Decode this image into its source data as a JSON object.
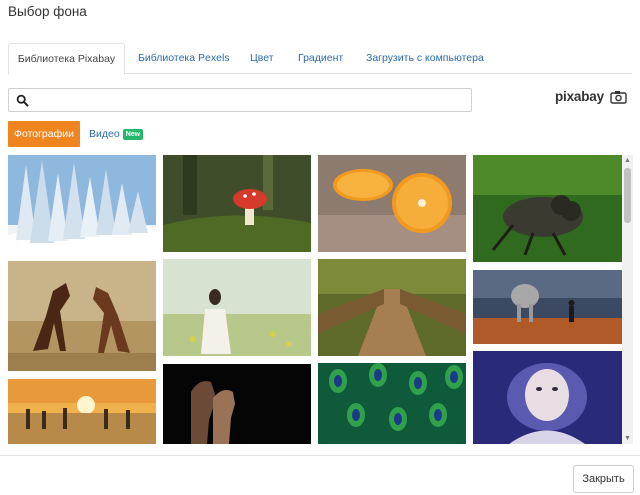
{
  "dialog": {
    "title": "Выбор фона"
  },
  "tabs": [
    {
      "label": "Библиотека Pixabay",
      "active": true
    },
    {
      "label": "Библиотека Pexels",
      "active": false
    },
    {
      "label": "Цвет",
      "active": false
    },
    {
      "label": "Градиент",
      "active": false
    },
    {
      "label": "Загрузить с компьютера",
      "active": false
    }
  ],
  "search": {
    "value": "",
    "placeholder": ""
  },
  "provider_logo": {
    "text": "pixabay",
    "icon": "camera-icon"
  },
  "media_tabs": {
    "photos_label": "Фотографии",
    "video_label": "Видео",
    "video_badge": "New"
  },
  "gallery": {
    "items": [
      {
        "subject": "snowy-forest"
      },
      {
        "subject": "red-mushroom"
      },
      {
        "subject": "orange-halves"
      },
      {
        "subject": "fly-macro"
      },
      {
        "subject": "two-horses"
      },
      {
        "subject": "woman-in-fog"
      },
      {
        "subject": "wooden-bridge"
      },
      {
        "subject": "elephant-and-man"
      },
      {
        "subject": "sunset-silhouettes"
      },
      {
        "subject": "couple-profiles"
      },
      {
        "subject": "peacock-feathers"
      },
      {
        "subject": "girl-face-art"
      }
    ]
  },
  "footer": {
    "close_label": "Закрыть"
  },
  "colors": {
    "accent_orange": "#f0851f",
    "link_blue": "#2a6ba8",
    "badge_green": "#25b86b"
  }
}
